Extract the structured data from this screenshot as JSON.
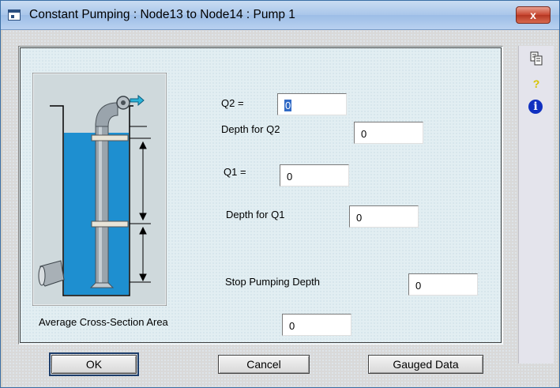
{
  "window": {
    "title": "Constant Pumping : Node13 to Node14 : Pump 1",
    "close_glyph": "x"
  },
  "fields": {
    "q2": {
      "label": "Q2 =",
      "value": "0"
    },
    "depth_q2": {
      "label": "Depth for Q2",
      "value": "0"
    },
    "q1": {
      "label": "Q1 =",
      "value": "0"
    },
    "depth_q1": {
      "label": "Depth for Q1",
      "value": "0"
    },
    "stop_depth": {
      "label": "Stop Pumping Depth",
      "value": "0"
    },
    "avg_area": {
      "label": "Average Cross-Section Area",
      "value": "0"
    }
  },
  "buttons": {
    "ok": "OK",
    "cancel": "Cancel",
    "gauged": "Gauged Data"
  },
  "sidebar": {
    "icons": [
      "copy-icon",
      "help-icon",
      "info-icon"
    ],
    "help_glyph": "?",
    "info_glyph": "i"
  },
  "colors": {
    "water": "#1e8fd0",
    "pipe": "#9aa4ac",
    "title_bar": "#b9d1f0",
    "close": "#c8452f",
    "info": "#1030c0"
  }
}
